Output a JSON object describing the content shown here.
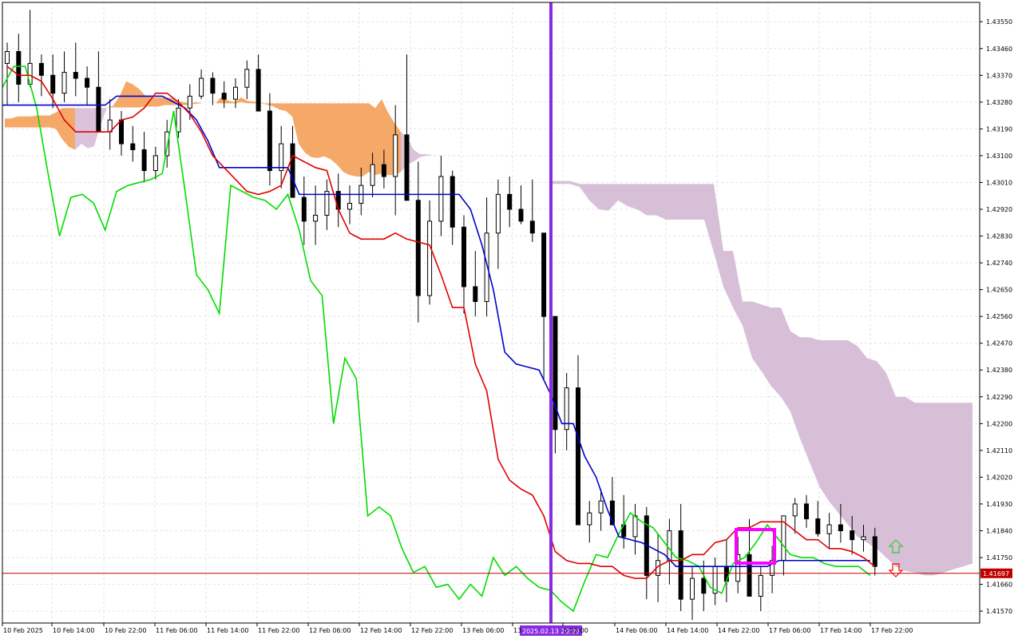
{
  "chart_data": {
    "type": "candlestick",
    "instrument_precision": 5,
    "ylim": [
      1.4153,
      1.43615
    ],
    "price_ticks": [
      "1.43550",
      "1.43460",
      "1.43370",
      "1.43280",
      "1.43190",
      "1.43100",
      "1.43010",
      "1.42920",
      "1.42830",
      "1.42740",
      "1.42650",
      "1.42560",
      "1.42470",
      "1.42380",
      "1.42290",
      "1.42200",
      "1.42110",
      "1.42020",
      "1.41930",
      "1.41840",
      "1.41750",
      "1.41660",
      "1.41570"
    ],
    "time_labels": [
      "10 Feb 2025",
      "10 Feb 14:00",
      "10 Feb 22:00",
      "11 Feb 06:00",
      "11 Feb 14:00",
      "11 Feb 22:00",
      "12 Feb 06:00",
      "12 Feb 14:00",
      "12 Feb 22:00",
      "13 Feb 06:00",
      "13",
      "b 22:00",
      "14 Feb 06:00",
      "14 Feb 14:00",
      "14 Feb 22:00",
      "17 Feb 06:00",
      "17 Feb 14:00",
      "17 Feb 22:00"
    ],
    "current_price": "1.41697",
    "crosshair_time_label": "2025.02.13 20:00",
    "grid": true,
    "colors": {
      "bull_candle": "#ffffff",
      "bear_candle": "#000000",
      "tenkan": "#e00000",
      "kijun": "#0000cc",
      "chikou": "#00dd00",
      "cloud_bull": "#f4a460",
      "cloud_bear": "#d8bfd8",
      "price_line": "#c00000",
      "crosshair": "#8a2be2",
      "highlight_box": "#ff00ff",
      "arrow_up": "#32cd32",
      "arrow_down": "#ff0000"
    },
    "candles": [
      [
        1.4341,
        1.4348,
        1.4327,
        1.4345
      ],
      [
        1.4345,
        1.4351,
        1.4328,
        1.4334
      ],
      [
        1.4334,
        1.4359,
        1.4333,
        1.4341
      ],
      [
        1.4341,
        1.4344,
        1.433,
        1.4337
      ],
      [
        1.4337,
        1.4344,
        1.4326,
        1.4331
      ],
      [
        1.4331,
        1.4345,
        1.4328,
        1.4338
      ],
      [
        1.4338,
        1.4348,
        1.433,
        1.4336
      ],
      [
        1.4336,
        1.434,
        1.4327,
        1.4333
      ],
      [
        1.4333,
        1.4345,
        1.4322,
        1.4318
      ],
      [
        1.4318,
        1.4329,
        1.4312,
        1.4322
      ],
      [
        1.4322,
        1.4325,
        1.431,
        1.4314
      ],
      [
        1.4314,
        1.432,
        1.4308,
        1.4312
      ],
      [
        1.4312,
        1.4318,
        1.4301,
        1.4305
      ],
      [
        1.4305,
        1.4313,
        1.4302,
        1.431
      ],
      [
        1.431,
        1.4322,
        1.4306,
        1.4318
      ],
      [
        1.4318,
        1.4329,
        1.4316,
        1.4326
      ],
      [
        1.4326,
        1.4334,
        1.4322,
        1.433
      ],
      [
        1.433,
        1.4339,
        1.4329,
        1.4336
      ],
      [
        1.4336,
        1.4338,
        1.4327,
        1.4331
      ],
      [
        1.4331,
        1.4335,
        1.4326,
        1.4329
      ],
      [
        1.4329,
        1.4336,
        1.4326,
        1.4333
      ],
      [
        1.4333,
        1.4342,
        1.4329,
        1.4339
      ],
      [
        1.4339,
        1.4344,
        1.433,
        1.4325
      ],
      [
        1.4325,
        1.4331,
        1.43,
        1.4305
      ],
      [
        1.4305,
        1.432,
        1.4299,
        1.4314
      ],
      [
        1.4314,
        1.432,
        1.4298,
        1.4296
      ],
      [
        1.4296,
        1.4303,
        1.428,
        1.4288
      ],
      [
        1.4288,
        1.43,
        1.428,
        1.429
      ],
      [
        1.429,
        1.4302,
        1.4285,
        1.4298
      ],
      [
        1.4298,
        1.4304,
        1.4286,
        1.4292
      ],
      [
        1.4292,
        1.43,
        1.4287,
        1.4294
      ],
      [
        1.4294,
        1.4306,
        1.429,
        1.43
      ],
      [
        1.43,
        1.4311,
        1.4296,
        1.4307
      ],
      [
        1.4307,
        1.4312,
        1.4299,
        1.4303
      ],
      [
        1.4303,
        1.4327,
        1.429,
        1.4317
      ],
      [
        1.4317,
        1.4344,
        1.4302,
        1.4295
      ],
      [
        1.4295,
        1.4308,
        1.4254,
        1.4263
      ],
      [
        1.4263,
        1.4295,
        1.426,
        1.4288
      ],
      [
        1.4288,
        1.431,
        1.4283,
        1.4303
      ],
      [
        1.4303,
        1.4305,
        1.428,
        1.4286
      ],
      [
        1.4286,
        1.429,
        1.4257,
        1.4266
      ],
      [
        1.4266,
        1.4278,
        1.4256,
        1.4261
      ],
      [
        1.4261,
        1.4296,
        1.4256,
        1.4284
      ],
      [
        1.4284,
        1.4302,
        1.4272,
        1.4297
      ],
      [
        1.4297,
        1.4303,
        1.4286,
        1.4292
      ],
      [
        1.4292,
        1.43,
        1.4287,
        1.4288
      ],
      [
        1.4288,
        1.4302,
        1.4281,
        1.4284
      ],
      [
        1.4284,
        1.4275,
        1.4235,
        1.4256
      ],
      [
        1.4256,
        1.4245,
        1.421,
        1.4218
      ],
      [
        1.4218,
        1.4237,
        1.4211,
        1.4232
      ],
      [
        1.4232,
        1.4243,
        1.4222,
        1.4186
      ],
      [
        1.4186,
        1.4194,
        1.418,
        1.419
      ],
      [
        1.419,
        1.4198,
        1.4184,
        1.4194
      ],
      [
        1.4194,
        1.4202,
        1.4188,
        1.4186
      ],
      [
        1.4186,
        1.4196,
        1.4178,
        1.4182
      ],
      [
        1.4182,
        1.4193,
        1.4176,
        1.4189
      ],
      [
        1.4189,
        1.4192,
        1.4161,
        1.4169
      ],
      [
        1.4169,
        1.4183,
        1.416,
        1.4174
      ],
      [
        1.4174,
        1.4188,
        1.4166,
        1.4184
      ],
      [
        1.4184,
        1.4193,
        1.4157,
        1.4161
      ],
      [
        1.4161,
        1.4172,
        1.4154,
        1.4168
      ],
      [
        1.4168,
        1.4174,
        1.4157,
        1.4163
      ],
      [
        1.4163,
        1.4175,
        1.4159,
        1.4172
      ],
      [
        1.4172,
        1.4181,
        1.416,
        1.4167
      ],
      [
        1.4167,
        1.4182,
        1.4163,
        1.4176
      ],
      [
        1.4176,
        1.4188,
        1.4166,
        1.4162
      ],
      [
        1.4162,
        1.4172,
        1.4157,
        1.4169
      ],
      [
        1.4169,
        1.4179,
        1.4163,
        1.4174
      ],
      [
        1.4174,
        1.4184,
        1.4169,
        1.4189
      ],
      [
        1.4189,
        1.4195,
        1.4183,
        1.4193
      ],
      [
        1.4193,
        1.4196,
        1.4185,
        1.4188
      ],
      [
        1.4188,
        1.4194,
        1.4182,
        1.4183
      ],
      [
        1.4183,
        1.419,
        1.4178,
        1.4186
      ],
      [
        1.4186,
        1.4193,
        1.418,
        1.4184
      ],
      [
        1.4184,
        1.4189,
        1.4176,
        1.4181
      ],
      [
        1.4181,
        1.4186,
        1.4177,
        1.4182
      ],
      [
        1.4182,
        1.4185,
        1.4169,
        1.4172
      ]
    ],
    "tenkan": [
      1.434,
      1.4337,
      1.4337,
      1.4335,
      1.4329,
      1.4322,
      1.4318,
      1.4318,
      1.4318,
      1.4318,
      1.4322,
      1.4323,
      1.4326,
      1.4331,
      1.4331,
      1.4328,
      1.4324,
      1.4318,
      1.431,
      1.4306,
      1.4302,
      1.4298,
      1.4297,
      1.4298,
      1.43,
      1.431,
      1.4308,
      1.4306,
      1.4305,
      1.4292,
      1.4284,
      1.4282,
      1.4282,
      1.4282,
      1.4284,
      1.4282,
      1.4281,
      1.428,
      1.427,
      1.4259,
      1.4259,
      1.424,
      1.4231,
      1.4208,
      1.4201,
      1.4198,
      1.4196,
      1.4189,
      1.4177,
      1.4174,
      1.4173,
      1.4173,
      1.4172,
      1.4172,
      1.4169,
      1.4168,
      1.4168,
      1.4172,
      1.4174,
      1.4174,
      1.4176,
      1.4176,
      1.418,
      1.4181,
      1.4185,
      1.4185,
      1.4187,
      1.4187,
      1.4187,
      1.4184,
      1.4181,
      1.4181,
      1.4178,
      1.4178,
      1.4177,
      1.4175,
      1.4172
    ],
    "kijun": [
      1.4327,
      1.4327,
      1.4327,
      1.4327,
      1.4327,
      1.4327,
      1.4327,
      1.4327,
      1.4327,
      1.4327,
      1.433,
      1.433,
      1.433,
      1.433,
      1.433,
      1.4328,
      1.4326,
      1.4322,
      1.4315,
      1.4306,
      1.4306,
      1.4306,
      1.4306,
      1.4306,
      1.4306,
      1.4306,
      1.4297,
      1.4297,
      1.4297,
      1.4297,
      1.4297,
      1.4297,
      1.4297,
      1.4297,
      1.4297,
      1.4297,
      1.4297,
      1.4297,
      1.4297,
      1.4297,
      1.4297,
      1.4292,
      1.428,
      1.4265,
      1.4244,
      1.424,
      1.4239,
      1.4238,
      1.423,
      1.422,
      1.422,
      1.4209,
      1.4202,
      1.4191,
      1.4182,
      1.4181,
      1.418,
      1.4178,
      1.4176,
      1.4172,
      1.4172,
      1.4172,
      1.4172,
      1.4172,
      1.4172,
      1.4172,
      1.4172,
      1.4172,
      1.4174,
      1.4174,
      1.4174,
      1.4174,
      1.4174,
      1.4174,
      1.4174,
      1.4174,
      1.4174
    ],
    "chikou": [
      1.4333,
      1.434,
      1.434,
      1.4326,
      1.4304,
      1.4283,
      1.4296,
      1.4297,
      1.4294,
      1.4285,
      1.4298,
      1.43,
      1.4301,
      1.4302,
      1.4304,
      1.4325,
      1.4298,
      1.427,
      1.4265,
      1.4257,
      1.43,
      1.4298,
      1.4296,
      1.4295,
      1.4292,
      1.4297,
      1.4285,
      1.4268,
      1.4263,
      1.422,
      1.4242,
      1.4235,
      1.4189,
      1.4192,
      1.4189,
      1.4178,
      1.417,
      1.4172,
      1.4165,
      1.4166,
      1.4161,
      1.4166,
      1.4162,
      1.4175,
      1.4169,
      1.4172,
      1.4168,
      1.4165,
      1.4164,
      1.416,
      1.4157,
      1.4167,
      1.4176,
      1.4175,
      1.4183,
      1.419,
      1.4187,
      1.4185,
      1.418,
      1.4175,
      1.4174,
      1.4172,
      1.4165,
      1.4163,
      1.4173,
      1.4175,
      1.418,
      1.4186,
      1.4181,
      1.4176,
      1.4175,
      1.4175,
      1.4173,
      1.4172,
      1.4172,
      1.4172,
      1.4169
    ],
    "cloud": [
      [
        1.43225,
        1.43195
      ],
      [
        1.43225,
        1.43195
      ],
      [
        1.43232,
        1.43195
      ],
      [
        1.43232,
        1.43195
      ],
      [
        1.43232,
        1.43195
      ],
      [
        1.43235,
        1.43195
      ],
      [
        1.43235,
        1.43195
      ],
      [
        1.43235,
        1.43195
      ],
      [
        1.43245,
        1.4319
      ],
      [
        1.4326,
        1.43155
      ],
      [
        1.4326,
        1.4313
      ],
      [
        1.4326,
        1.4312
      ],
      [
        1.4326,
        1.4314
      ],
      [
        1.4326,
        1.43125
      ],
      [
        1.4326,
        1.43132
      ],
      [
        1.4326,
        1.43205
      ],
      [
        1.4326,
        1.4326
      ],
      [
        1.4327,
        1.43262
      ],
      [
        1.433,
        1.43262
      ],
      [
        1.4335,
        1.43262
      ],
      [
        1.4334,
        1.43262
      ],
      [
        1.43325,
        1.43262
      ],
      [
        1.43302,
        1.43265
      ],
      [
        1.43295,
        1.43265
      ],
      [
        1.43295,
        1.43265
      ],
      [
        1.43295,
        1.4327
      ],
      [
        1.43295,
        1.4327
      ],
      [
        1.43285,
        1.4327
      ],
      [
        1.4328,
        1.4327
      ],
      [
        1.43275,
        1.43272
      ],
      [
        1.4328,
        1.43275
      ],
      [
        1.43276,
        1.43276
      ],
      [
        1.43276,
        1.43276
      ],
      [
        1.43276,
        1.43276
      ],
      [
        1.433,
        1.43276
      ],
      [
        1.43285,
        1.43276
      ],
      [
        1.4328,
        1.43276
      ],
      [
        1.43296,
        1.4328
      ],
      [
        1.43284,
        1.43276
      ],
      [
        1.43282,
        1.43276
      ],
      [
        1.43276,
        1.43276
      ],
      [
        1.43276,
        1.43272
      ],
      [
        1.43276,
        1.43266
      ],
      [
        1.43276,
        1.43255
      ],
      [
        1.43276,
        1.4325
      ],
      [
        1.43276,
        1.43232
      ],
      [
        1.43276,
        1.4314
      ],
      [
        1.43276,
        1.4311
      ],
      [
        1.43276,
        1.43095
      ],
      [
        1.43276,
        1.43092
      ],
      [
        1.43276,
        1.43098
      ],
      [
        1.43276,
        1.43088
      ],
      [
        1.43276,
        1.4307
      ],
      [
        1.43276,
        1.43045
      ],
      [
        1.43276,
        1.43035
      ],
      [
        1.43276,
        1.4303
      ],
      [
        1.43276,
        1.4303
      ],
      [
        1.43276,
        1.43045
      ],
      [
        1.4326,
        1.43035
      ],
      [
        1.4329,
        1.4304
      ],
      [
        1.43245,
        1.43035
      ],
      [
        1.4321,
        1.43035
      ],
      [
        1.4318,
        1.43045
      ],
      [
        1.4316,
        1.4307
      ],
      [
        1.4312,
        1.4308
      ],
      [
        1.43105,
        1.43095
      ],
      [
        1.43105,
        1.431
      ],
      [
        1.43102,
        1.43102
      ],
      [
        1.43102,
        1.43102
      ]
    ],
    "cloud_future": [
      [
        1.43015,
        1.43005
      ],
      [
        1.43015,
        1.43005
      ],
      [
        1.43015,
        1.43005
      ],
      [
        1.43005,
        1.42995
      ],
      [
        1.43005,
        1.4295
      ],
      [
        1.43005,
        1.4292
      ],
      [
        1.43005,
        1.42915
      ],
      [
        1.43005,
        1.4295
      ],
      [
        1.43005,
        1.4293
      ],
      [
        1.43005,
        1.4292
      ],
      [
        1.43005,
        1.429
      ],
      [
        1.43005,
        1.429
      ],
      [
        1.43005,
        1.42885
      ],
      [
        1.43005,
        1.42885
      ],
      [
        1.43005,
        1.42885
      ],
      [
        1.43005,
        1.42885
      ],
      [
        1.43005,
        1.42885
      ],
      [
        1.43005,
        1.42775
      ],
      [
        1.4278,
        1.4266
      ],
      [
        1.4278,
        1.4259
      ],
      [
        1.4261,
        1.4253
      ],
      [
        1.4261,
        1.4242
      ],
      [
        1.426,
        1.42375
      ],
      [
        1.4259,
        1.42325
      ],
      [
        1.4259,
        1.4229
      ],
      [
        1.4251,
        1.4224
      ],
      [
        1.4249,
        1.4215
      ],
      [
        1.4249,
        1.4207
      ],
      [
        1.4248,
        1.4199
      ],
      [
        1.4248,
        1.4194
      ],
      [
        1.4248,
        1.419
      ],
      [
        1.4248,
        1.4186
      ],
      [
        1.4246,
        1.4182
      ],
      [
        1.4242,
        1.418
      ],
      [
        1.4241,
        1.4178
      ],
      [
        1.4237,
        1.4175
      ],
      [
        1.4229,
        1.4172
      ],
      [
        1.4229,
        1.41705
      ],
      [
        1.4227,
        1.417
      ],
      [
        1.4227,
        1.4169
      ],
      [
        1.4227,
        1.4169
      ],
      [
        1.4227,
        1.417
      ],
      [
        1.4227,
        1.4171
      ],
      [
        1.4227,
        1.4172
      ],
      [
        1.4227,
        1.4173
      ]
    ]
  }
}
